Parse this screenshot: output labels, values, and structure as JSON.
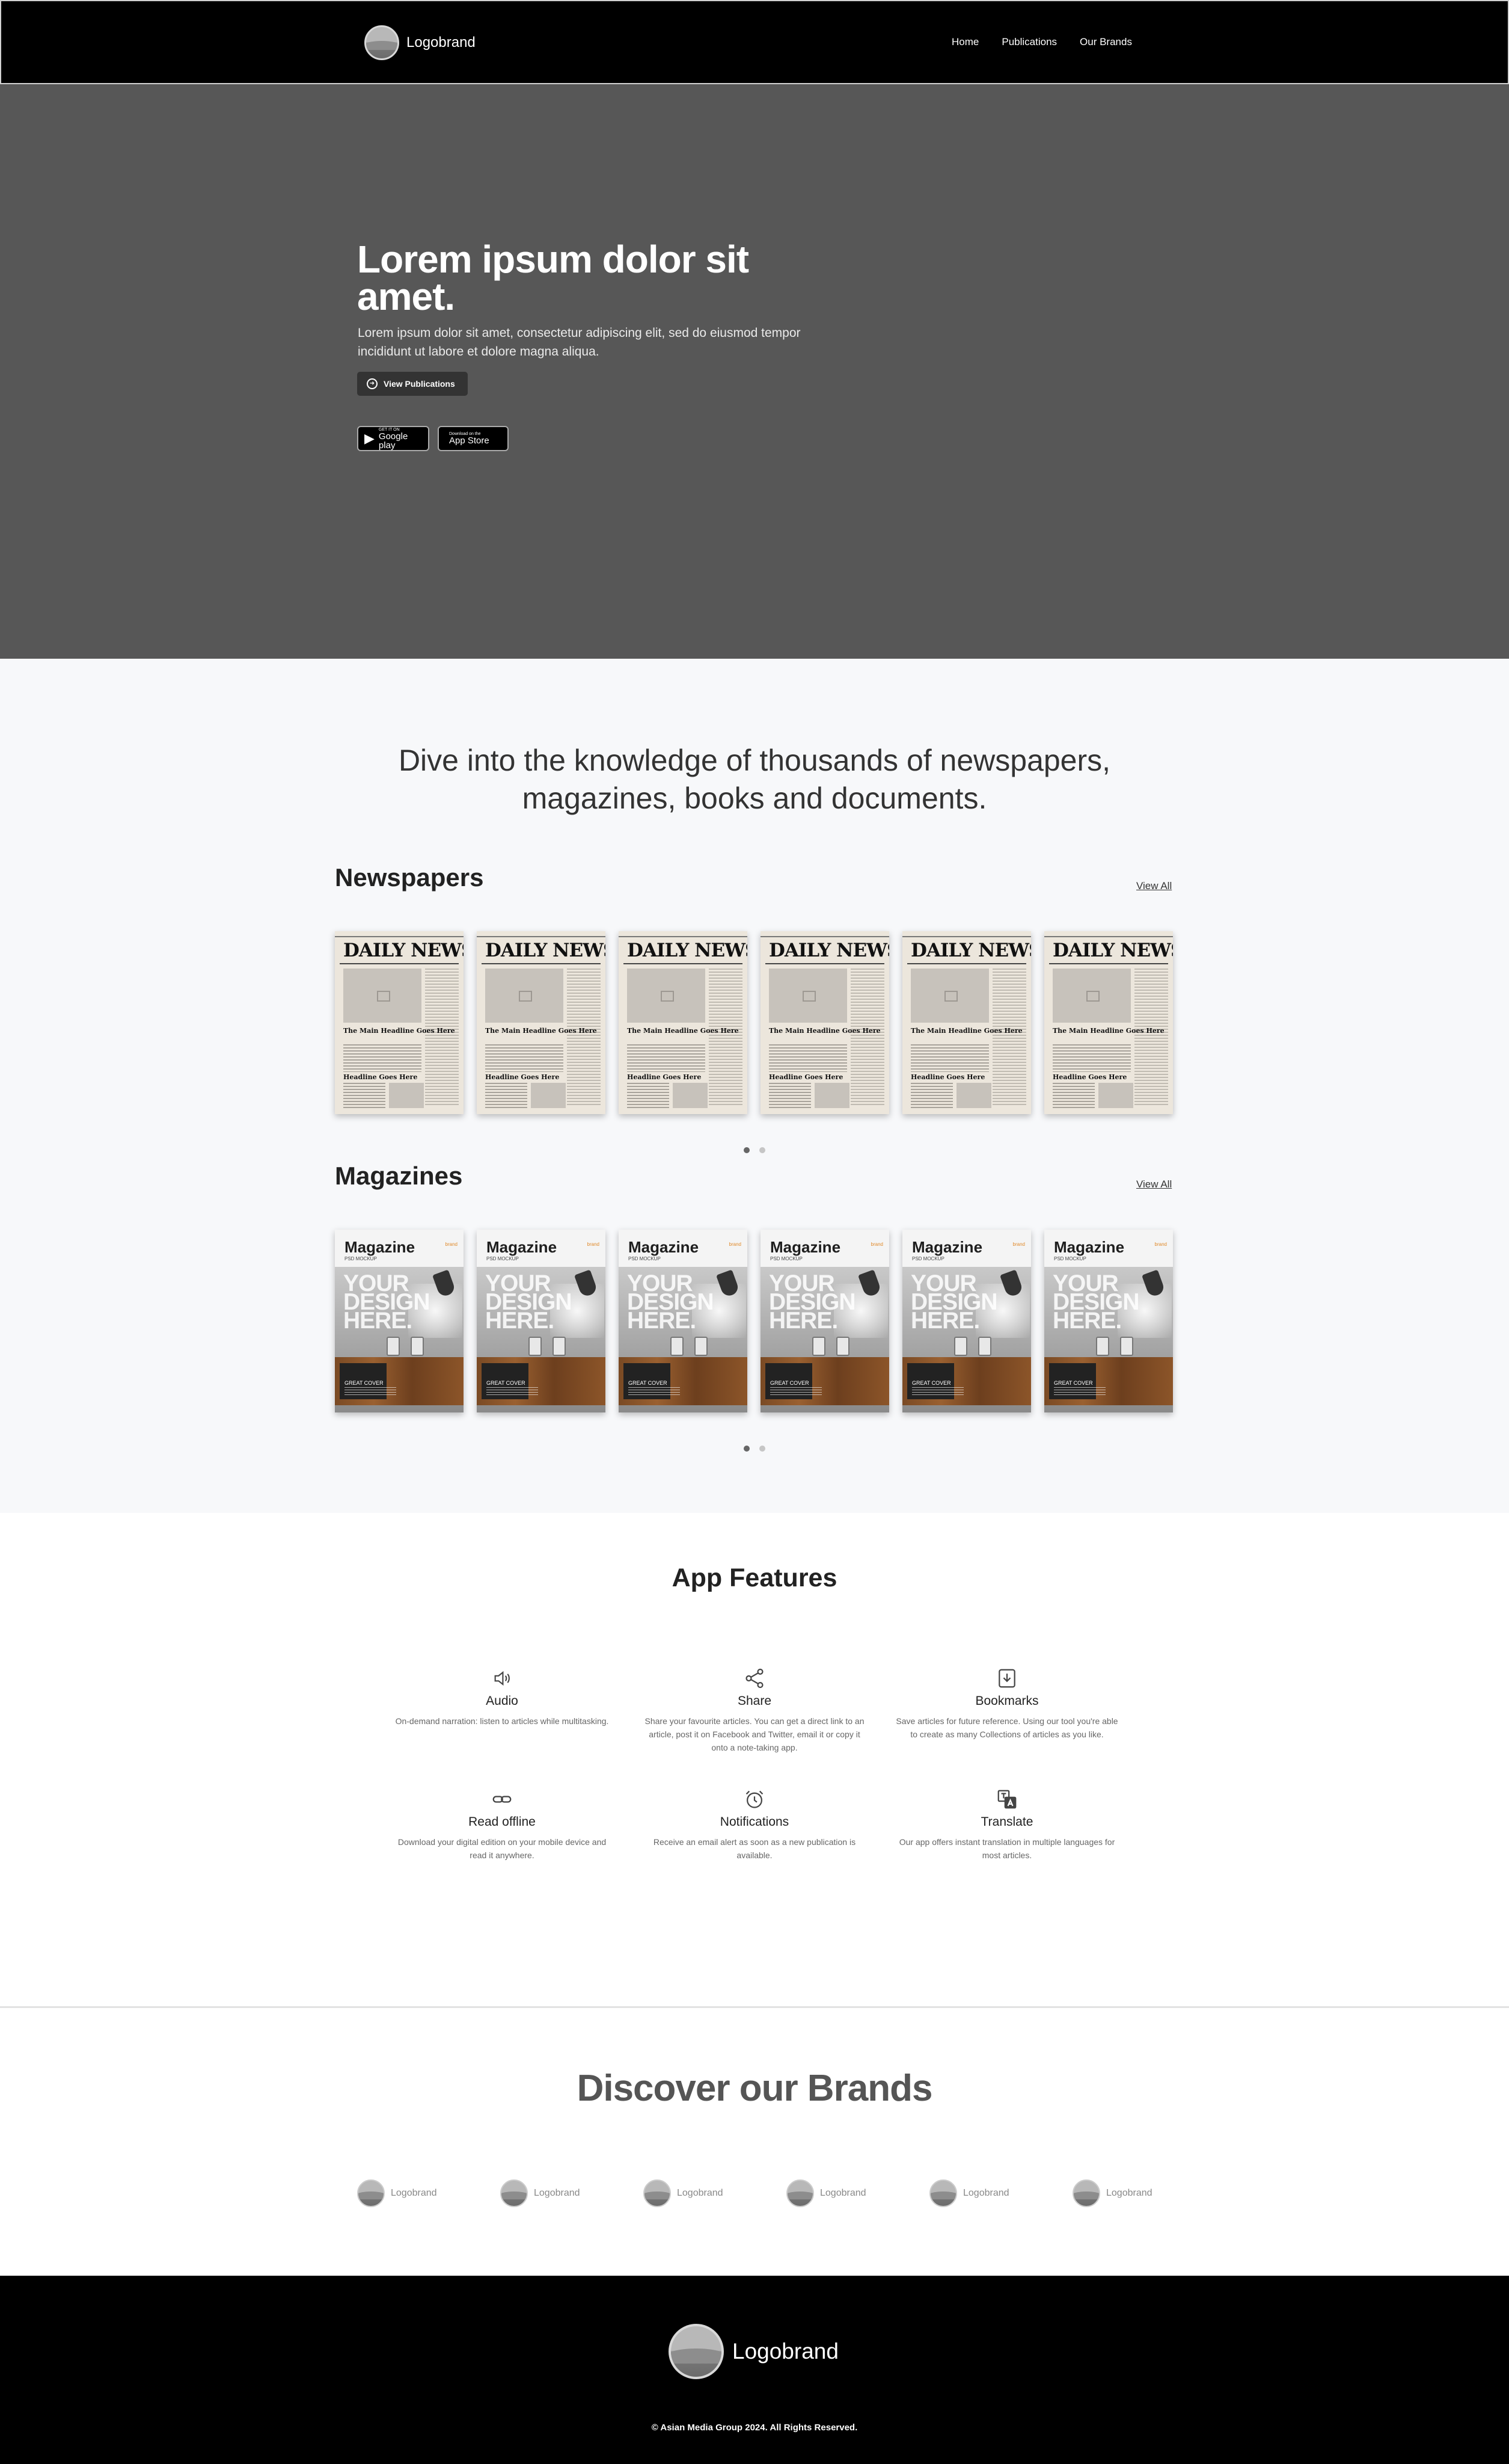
{
  "nav": {
    "logo_text": "Logobrand",
    "links": [
      "Home",
      "Publications",
      "Our Brands"
    ]
  },
  "hero": {
    "title": "Lorem ipsum dolor sit amet.",
    "subtitle": "Lorem ipsum dolor sit amet, consectetur adipiscing elit, sed do eiusmod tempor incididunt ut labore et dolore magna aliqua.",
    "button_label": "View Publications",
    "google_play": {
      "small": "GET IT ON",
      "big": "Google play"
    },
    "app_store": {
      "small": "Download on the",
      "big": "App Store"
    }
  },
  "catalog": {
    "tagline": "Dive into the knowledge of thousands of newspapers, magazines, books and documents.",
    "newspapers": {
      "title": "Newspapers",
      "view_all": "View All",
      "item": {
        "masthead": "DAILY NEWS",
        "headline": "The Main Headline Goes Here",
        "headline2": "Headline Goes Here"
      },
      "count": 6
    },
    "magazines": {
      "title": "Magazines",
      "view_all": "View All",
      "item": {
        "title": "Magazine",
        "subtitle": "PSD MOCKUP",
        "big": "YOUR DESIGN HERE.",
        "cover_label": "GREAT COVER",
        "mark": "brand"
      },
      "count": 6
    }
  },
  "features": {
    "title": "App Features",
    "items": [
      {
        "icon": "speaker-icon",
        "name": "Audio",
        "desc": "On-demand narration: listen to articles while multitasking."
      },
      {
        "icon": "share-icon",
        "name": "Share",
        "desc": "Share your favourite articles. You can get a direct link to an article, post it on Facebook and Twitter, email it or copy it onto a note-taking app."
      },
      {
        "icon": "bookmark-icon",
        "name": "Bookmarks",
        "desc": "Save articles for future reference. Using our tool you're able to create as many Collections of articles as you like."
      },
      {
        "icon": "link-icon",
        "name": "Read offline",
        "desc": "Download your digital edition on your mobile device and read it anywhere."
      },
      {
        "icon": "alarm-clock-icon",
        "name": "Notifications",
        "desc": "Receive an email alert as soon as a new publication is available."
      },
      {
        "icon": "translate-icon",
        "name": "Translate",
        "desc": "Our app offers instant translation in multiple languages for most articles."
      }
    ]
  },
  "brands": {
    "title": "Discover our Brands",
    "items": [
      "Logobrand",
      "Logobrand",
      "Logobrand",
      "Logobrand",
      "Logobrand",
      "Logobrand"
    ]
  },
  "footer": {
    "logo_text": "Logobrand",
    "copyright": "© Asian Media Group 2024. All Rights Reserved."
  }
}
